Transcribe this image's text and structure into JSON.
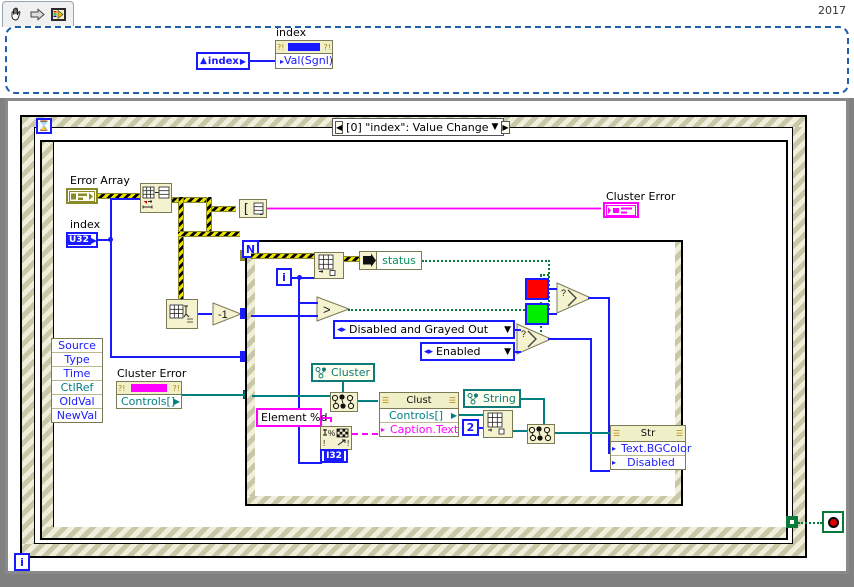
{
  "window": {
    "version_tag": "2017",
    "toolbar": {
      "items": [
        {
          "name": "hand-tool-icon",
          "label": "Operate Value"
        },
        {
          "name": "arrow-right-icon",
          "label": "Run"
        },
        {
          "name": "vi-icon",
          "label": "VI Icon"
        }
      ]
    }
  },
  "front_panel": {
    "index_control": {
      "label": "index",
      "terminal_text": "index"
    },
    "index_property_node": {
      "title": "index",
      "properties": [
        "Val(Sgnl)"
      ]
    }
  },
  "event_structure": {
    "case_selector": "[0] \"index\": Value Change",
    "left_arrow": "◀",
    "right_arrow": "▶",
    "dropdown_arrow": "▼",
    "timeout_terminal": "timeout",
    "event_data_node": {
      "items": [
        "Source",
        "Type",
        "Time",
        "CtlRef",
        "OldVal",
        "NewVal"
      ]
    }
  },
  "while_loop": {
    "iteration_terminal": "i",
    "stop_terminal": "stop"
  },
  "for_loop": {
    "count_terminal": "N",
    "iteration_terminal": "i"
  },
  "terminals": {
    "error_array": {
      "label": "Error Array",
      "type": "array"
    },
    "index": {
      "label": "index",
      "type": "U32"
    },
    "cluster_error_indicator": {
      "label": "Cluster Error",
      "type": "cluster"
    },
    "cluster_error_ref": {
      "label": "Cluster Error",
      "property": "Controls[]"
    },
    "status": {
      "label": "status"
    }
  },
  "constants": {
    "decrement": "-1",
    "element_format": "Element %d",
    "index_two": "2",
    "format_type": "I32",
    "enum_disabled": "Disabled and Grayed Out",
    "enum_enabled": "Enabled",
    "color_red": "#ff0000",
    "color_green": "#00ee00"
  },
  "class_constants": {
    "cluster": "Cluster",
    "string": "String"
  },
  "property_nodes": {
    "clust": {
      "title": "Clust",
      "properties": [
        "Controls[]",
        "Caption.Text"
      ]
    },
    "str": {
      "title": "Str",
      "properties": [
        "Text.BGColor",
        "Disabled"
      ]
    }
  },
  "colors": {
    "wire_blue": "#1a1aff",
    "wire_teal": "#008080",
    "wire_magenta": "#ff00ff",
    "wire_green_dotted": "#0a7a3a",
    "node_fill": "#f5f2cf",
    "node_border": "#7a7a55",
    "class_teal": "#0e7a7a"
  }
}
